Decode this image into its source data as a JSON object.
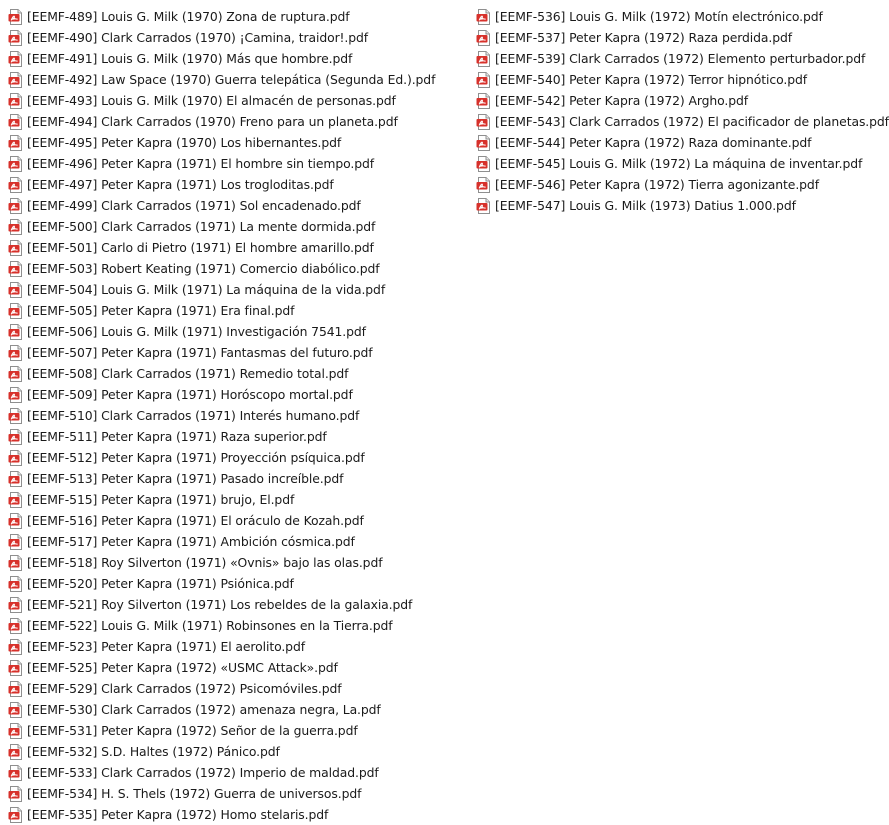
{
  "icon": "pdf-file-icon",
  "colors": {
    "icon_accent": "#d7312b",
    "icon_paper": "#ffffff",
    "text": "#1a1a1a"
  },
  "files": {
    "left": [
      "[EEMF-489] Louis G. Milk (1970) Zona de ruptura.pdf",
      "[EEMF-490] Clark Carrados (1970) ¡Camina, traidor!.pdf",
      "[EEMF-491] Louis G. Milk (1970) Más que hombre.pdf",
      "[EEMF-492] Law Space (1970) Guerra telepática (Segunda Ed.).pdf",
      "[EEMF-493] Louis G. Milk (1970) El almacén de personas.pdf",
      "[EEMF-494] Clark Carrados (1970) Freno para un planeta.pdf",
      "[EEMF-495] Peter Kapra (1970) Los hibernantes.pdf",
      "[EEMF-496] Peter Kapra (1971) El hombre sin tiempo.pdf",
      "[EEMF-497] Peter Kapra (1971) Los trogloditas.pdf",
      "[EEMF-499] Clark Carrados (1971) Sol encadenado.pdf",
      "[EEMF-500] Clark Carrados (1971) La mente dormida.pdf",
      "[EEMF-501] Carlo di Pietro (1971) El hombre amarillo.pdf",
      "[EEMF-503] Robert Keating (1971) Comercio diabólico.pdf",
      "[EEMF-504] Louis G. Milk (1971) La máquina de la vida.pdf",
      "[EEMF-505] Peter Kapra (1971) Era final.pdf",
      "[EEMF-506] Louis G. Milk (1971) Investigación 7541.pdf",
      "[EEMF-507] Peter Kapra (1971) Fantasmas del futuro.pdf",
      "[EEMF-508] Clark Carrados (1971) Remedio total.pdf",
      "[EEMF-509] Peter Kapra (1971) Horóscopo mortal.pdf",
      "[EEMF-510] Clark Carrados (1971) Interés humano.pdf",
      "[EEMF-511] Peter Kapra (1971) Raza superior.pdf",
      "[EEMF-512] Peter Kapra (1971) Proyección psíquica.pdf",
      "[EEMF-513] Peter Kapra (1971) Pasado increíble.pdf",
      "[EEMF-515] Peter Kapra (1971) brujo, El.pdf",
      "[EEMF-516] Peter Kapra (1971) El oráculo de Kozah.pdf",
      "[EEMF-517] Peter Kapra (1971) Ambición cósmica.pdf",
      "[EEMF-518] Roy Silverton (1971) «Ovnis» bajo las olas.pdf",
      "[EEMF-520] Peter Kapra (1971) Psiónica.pdf",
      "[EEMF-521] Roy Silverton (1971) Los rebeldes de la galaxia.pdf",
      "[EEMF-522] Louis G. Milk (1971) Robinsones en la Tierra.pdf",
      "[EEMF-523] Peter Kapra (1971) El aerolito.pdf",
      "[EEMF-525] Peter Kapra (1972) «USMC Attack».pdf",
      "[EEMF-529] Clark Carrados (1972) Psicomóviles.pdf",
      "[EEMF-530] Clark Carrados (1972) amenaza negra, La.pdf",
      "[EEMF-531] Peter Kapra (1972) Señor de la guerra.pdf",
      "[EEMF-532] S.D. Haltes (1972) Pánico.pdf",
      "[EEMF-533] Clark Carrados (1972) Imperio de maldad.pdf",
      "[EEMF-534] H. S. Thels (1972) Guerra de universos.pdf",
      "[EEMF-535] Peter Kapra (1972) Homo stelaris.pdf"
    ],
    "right": [
      "[EEMF-536] Louis G. Milk (1972) Motín electrónico.pdf",
      "[EEMF-537] Peter Kapra (1972) Raza perdida.pdf",
      "[EEMF-539] Clark Carrados (1972) Elemento perturbador.pdf",
      "[EEMF-540] Peter Kapra (1972) Terror hipnótico.pdf",
      "[EEMF-542] Peter Kapra (1972) Argho.pdf",
      "[EEMF-543] Clark Carrados (1972) El pacificador de planetas.pdf",
      "[EEMF-544] Peter Kapra (1972) Raza dominante.pdf",
      "[EEMF-545] Louis G. Milk (1972) La máquina de inventar.pdf",
      "[EEMF-546] Peter Kapra (1972) Tierra agonizante.pdf",
      "[EEMF-547] Louis G. Milk (1973) Datius 1.000.pdf"
    ]
  }
}
